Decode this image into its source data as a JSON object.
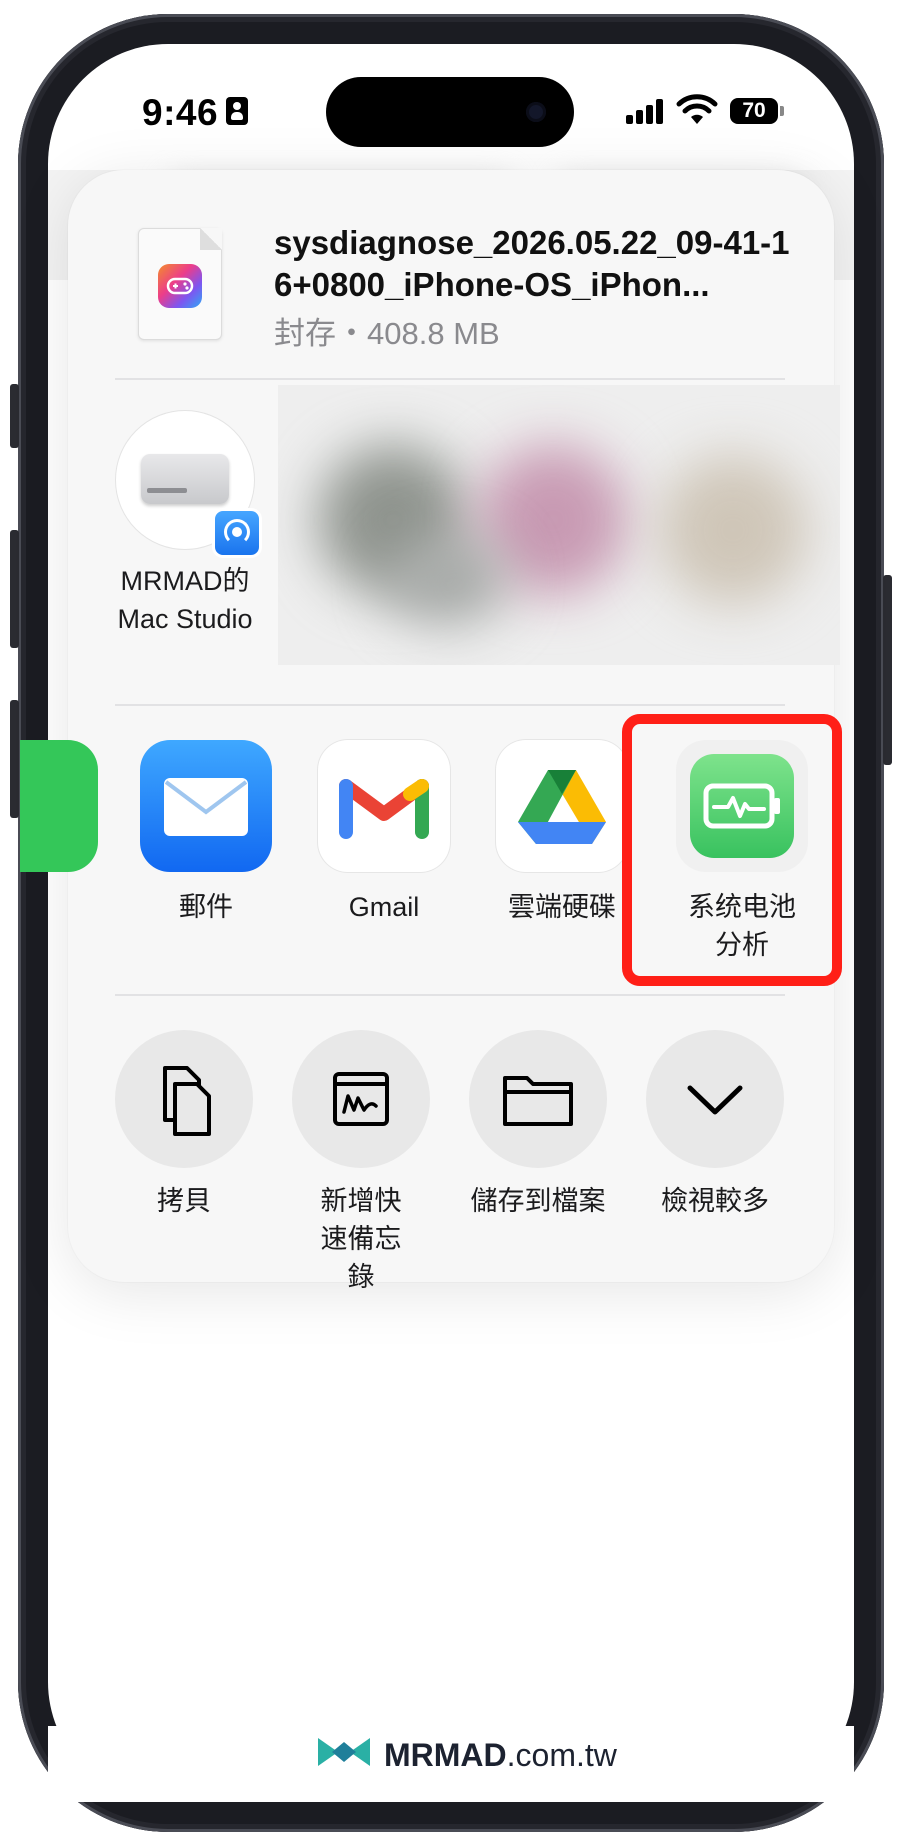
{
  "status_bar": {
    "time": "9:46",
    "battery": "70"
  },
  "file": {
    "name": "sysdiagnose_2026.05.22_09-41-16+0800_iPhone-OS_iPhon...",
    "meta": "封存・408.8 MB"
  },
  "airdrop": {
    "device_label": "MRMAD的 Mac Studio"
  },
  "apps": [
    {
      "label": "郵件",
      "icon": "mail-icon"
    },
    {
      "label": "Gmail",
      "icon": "gmail-icon"
    },
    {
      "label": "雲端硬碟",
      "icon": "google-drive-icon"
    },
    {
      "label": "系统电池分析",
      "icon": "battery-analysis-icon",
      "highlighted": true
    }
  ],
  "actions": [
    {
      "label": "拷貝",
      "icon": "copy-icon"
    },
    {
      "label": "新增快速備忘錄",
      "icon": "quick-note-icon"
    },
    {
      "label": "儲存到檔案",
      "icon": "folder-icon"
    },
    {
      "label": "檢視較多",
      "icon": "chevron-down-icon"
    }
  ],
  "footer": {
    "brand": "MRMAD",
    "domain": ".com.tw"
  },
  "colors": {
    "highlight": "#ff1f17",
    "mail_blue": "#1f86ff",
    "battery_green": "#4fd66b"
  }
}
